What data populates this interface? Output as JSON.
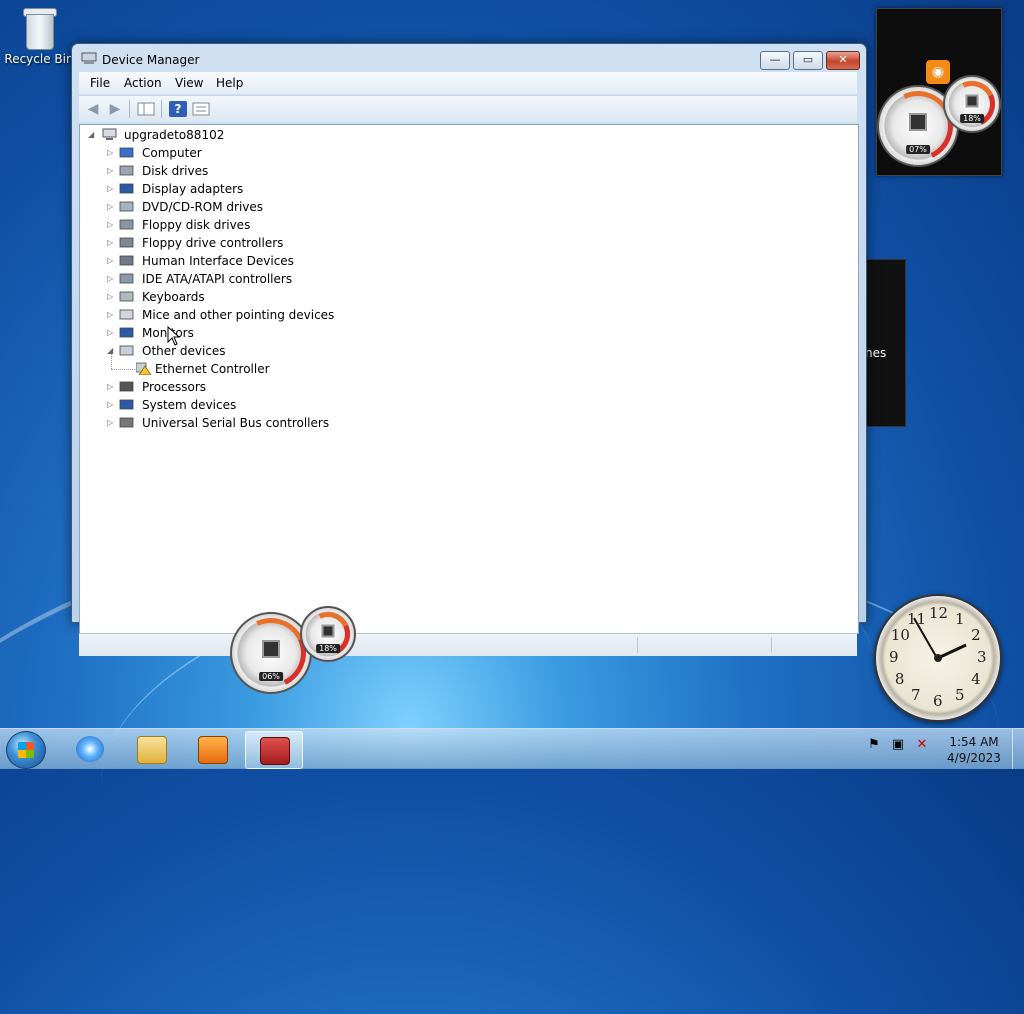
{
  "desktop": {
    "recycle_bin_label": "Recycle Bin"
  },
  "gadgets": {
    "meter_top": {
      "cpu_pct": "07%",
      "mem_pct": "18%"
    },
    "meter_bottom": {
      "cpu_pct": "06%",
      "mem_pct": "18%"
    },
    "side_text": "nes",
    "clock_numbers": [
      "12",
      "1",
      "2",
      "3",
      "4",
      "5",
      "6",
      "7",
      "8",
      "9",
      "10",
      "11"
    ]
  },
  "window": {
    "title": "Device Manager",
    "controls": {
      "minimize": "—",
      "maximize": "▭",
      "close": "✕"
    },
    "menu": [
      "File",
      "Action",
      "View",
      "Help"
    ],
    "toolbar": {
      "back": "◀",
      "forward": "▶",
      "help": "?"
    },
    "tree": {
      "root": "upgradeto88102",
      "categories": [
        {
          "label": "Computer",
          "icon": "computer-icon",
          "expanded": false
        },
        {
          "label": "Disk drives",
          "icon": "disk-drive-icon",
          "expanded": false
        },
        {
          "label": "Display adapters",
          "icon": "display-adapter-icon",
          "expanded": false
        },
        {
          "label": "DVD/CD-ROM drives",
          "icon": "dvd-drive-icon",
          "expanded": false
        },
        {
          "label": "Floppy disk drives",
          "icon": "floppy-disk-icon",
          "expanded": false
        },
        {
          "label": "Floppy drive controllers",
          "icon": "floppy-controller-icon",
          "expanded": false
        },
        {
          "label": "Human Interface Devices",
          "icon": "hid-icon",
          "expanded": false
        },
        {
          "label": "IDE ATA/ATAPI controllers",
          "icon": "ide-controller-icon",
          "expanded": false
        },
        {
          "label": "Keyboards",
          "icon": "keyboard-icon",
          "expanded": false
        },
        {
          "label": "Mice and other pointing devices",
          "icon": "mouse-icon",
          "expanded": false
        },
        {
          "label": "Monitors",
          "icon": "monitor-icon",
          "expanded": false
        },
        {
          "label": "Other devices",
          "icon": "unknown-device-icon",
          "expanded": true
        },
        {
          "label": "Processors",
          "icon": "processor-icon",
          "expanded": false
        },
        {
          "label": "System devices",
          "icon": "system-device-icon",
          "expanded": false
        },
        {
          "label": "Universal Serial Bus controllers",
          "icon": "usb-icon",
          "expanded": false
        }
      ],
      "other_devices_children": [
        {
          "label": "Ethernet Controller",
          "icon": "warning-device-icon"
        }
      ]
    }
  },
  "taskbar": {
    "time": "1:54 AM",
    "date": "4/9/2023",
    "pinned": [
      "internet-explorer-icon",
      "file-explorer-icon",
      "media-player-icon",
      "device-manager-icon"
    ]
  },
  "colors": {
    "accent": "#2f5fb5",
    "warning": "#f2c12e",
    "close_button": "#c4442c"
  }
}
